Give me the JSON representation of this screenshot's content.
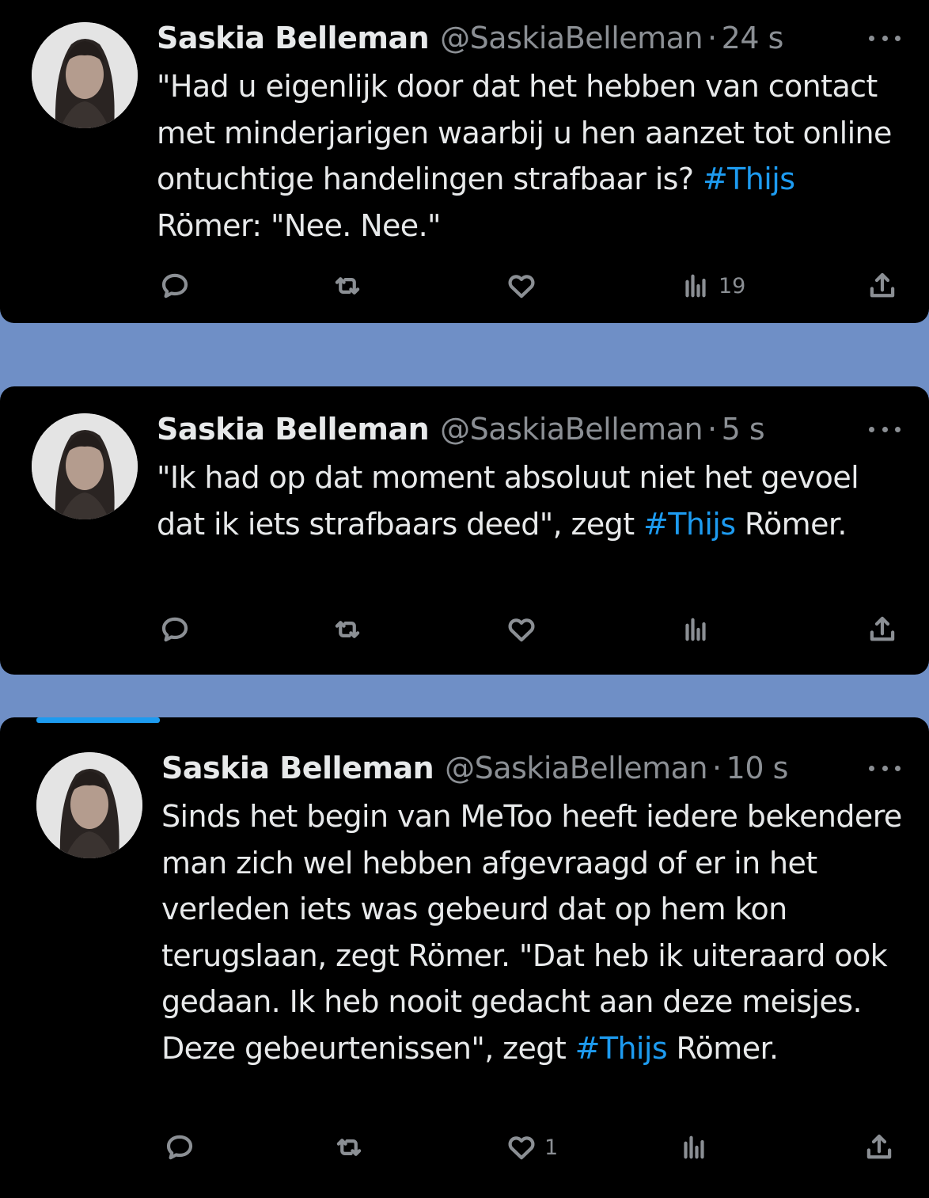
{
  "tweets": [
    {
      "author": {
        "name": "Saskia Belleman",
        "handle": "@SaskiaBelleman"
      },
      "separator": "·",
      "time": "24 s",
      "text_parts": [
        "\"Had u eigenlijk door dat het hebben van contact met minderjarigen waarbij u hen aanzet tot online ontuchtige handelingen strafbaar is? ",
        "#Thijs",
        " Römer: \"Nee. Nee.\""
      ],
      "stats": {
        "replies": "",
        "retweets": "",
        "likes": "",
        "views": "19"
      }
    },
    {
      "author": {
        "name": "Saskia Belleman",
        "handle": "@SaskiaBelleman"
      },
      "separator": "·",
      "time": "5 s",
      "text_parts": [
        "\"Ik had op dat moment absoluut niet het gevoel dat ik iets strafbaars deed\", zegt ",
        "#Thijs",
        " Römer."
      ],
      "stats": {
        "replies": "",
        "retweets": "",
        "likes": "",
        "views": ""
      }
    },
    {
      "author": {
        "name": "Saskia Belleman",
        "handle": "@SaskiaBelleman"
      },
      "separator": "·",
      "time": "10 s",
      "text_parts": [
        "Sinds het begin van MeToo heeft iedere bekendere man zich wel hebben afgevraagd of er in het verleden iets was gebeurd dat op hem kon terugslaan, zegt Römer. \"Dat heb ik uiteraard ook gedaan. Ik heb nooit gedacht aan deze meisjes. Deze gebeurtenissen\", zegt ",
        "#Thijs",
        " Römer."
      ],
      "stats": {
        "replies": "",
        "retweets": "",
        "likes": "1",
        "views": ""
      }
    }
  ],
  "icons": {
    "reply": "reply-icon",
    "retweet": "retweet-icon",
    "like": "heart-icon",
    "views": "views-chart-icon",
    "share": "share-icon",
    "more": "more-icon"
  },
  "colors": {
    "background_panel": "#000000",
    "page_background": "#6f8fc6",
    "hashtag": "#1d9bf0",
    "muted": "#8b8f94",
    "text": "#e7e9ea"
  }
}
